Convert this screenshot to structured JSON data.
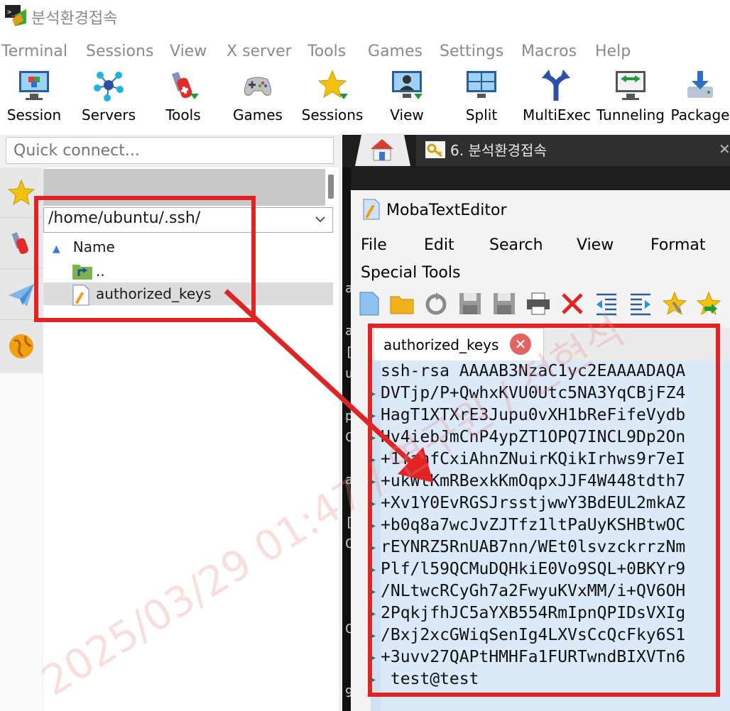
{
  "window": {
    "title": "분석환경접속"
  },
  "menubar": {
    "items": [
      {
        "label": "Terminal"
      },
      {
        "label": "Sessions"
      },
      {
        "label": "View"
      },
      {
        "label": "X server"
      },
      {
        "label": "Tools"
      },
      {
        "label": "Games"
      },
      {
        "label": "Settings"
      },
      {
        "label": "Macros"
      },
      {
        "label": "Help"
      }
    ]
  },
  "toolbar": {
    "buttons": [
      {
        "label": "Session",
        "icon": "monitor-cubes-icon"
      },
      {
        "label": "Servers",
        "icon": "network-nodes-icon"
      },
      {
        "label": "Tools",
        "icon": "swiss-knife-icon"
      },
      {
        "label": "Games",
        "icon": "gamepad-icon"
      },
      {
        "label": "Sessions",
        "icon": "star-icon"
      },
      {
        "label": "View",
        "icon": "user-monitor-icon"
      },
      {
        "label": "Split",
        "icon": "split-window-icon"
      },
      {
        "label": "MultiExec",
        "icon": "fork-icon"
      },
      {
        "label": "Tunneling",
        "icon": "tunnel-monitor-icon"
      },
      {
        "label": "Package",
        "icon": "package-download-icon"
      }
    ]
  },
  "left": {
    "quick_connect_placeholder": "Quick connect...",
    "path": "/home/ubuntu/.ssh/",
    "column_name": "Name",
    "files": [
      {
        "name": "..",
        "icon": "folder-up-icon"
      },
      {
        "name": "authorized_keys",
        "icon": "text-file-icon"
      }
    ]
  },
  "tabs": {
    "session_label": "6. 분석환경접속"
  },
  "editor": {
    "title": "MobaTextEditor",
    "menu": [
      "File",
      "Edit",
      "Search",
      "View",
      "Format",
      "Special Tools"
    ],
    "file_tab": "authorized_keys",
    "lines": [
      "ssh-rsa AAAAB3NzaC1yc2EAAAADAQA",
      "DVTjp/P+QwhxKVU0Utc5NA3YqCBjFZ4",
      "HagT1XTXrE3Jupu0vXH1bReFifeVydb",
      "Hv4iebJmCnP4ypZT1OPQ7INCL9Dp2On",
      "+1YahfCxiAhnZNuirKQikIrhws9r7eI",
      "+ukWtKmRBexkKmOqpxJJF4W448tdth7",
      "+Xv1Y0EvRGSJrsstjwwY3BdEUL2mkAZ",
      "+b0q8a7wcJvZJTfz1ltPaUyKSHBtwOC",
      "rEYNRZ5RnUAB7nn/WEt0lsvzckrrzNm",
      "Plf/l59QCMuDQHkiE0Vo9SQL+0BKYr9",
      "/NLtwcRCyGh7a2FwyuKVxMM/i+QV6OH",
      "2PqkjfhJC5aYXB554RmIpnQPIDsVXIg",
      "/Bxj2xcGWiqSenIg4LXVsCcQcFky6S1",
      "+3uvv27QAPtHMHFa1FURTwndBIXVTn6",
      " test@test"
    ]
  },
  "terminal_side_chars": [
    "a",
    "",
    "a",
    "[",
    "u",
    "",
    "p",
    "C",
    "",
    "a",
    "",
    "[",
    "C",
    "",
    "",
    "",
    "C",
    "",
    "",
    "9"
  ],
  "watermark": "2025/03/29 01:47 / 연구원 / 전현석"
}
